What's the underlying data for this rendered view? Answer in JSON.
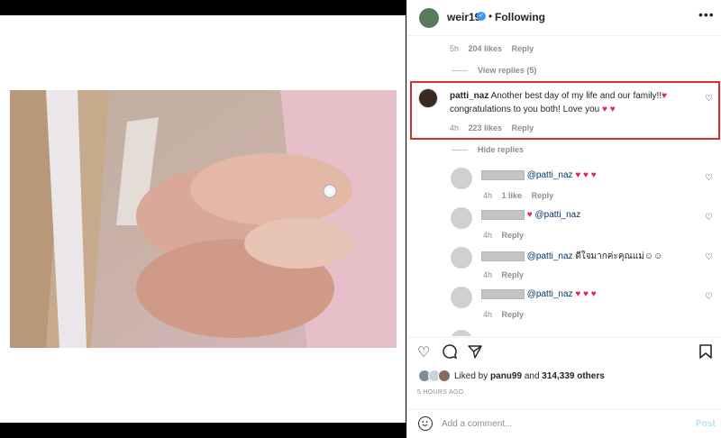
{
  "post": {
    "username": "weir19",
    "verified_mark": "✓",
    "separator": "•",
    "follow_label": "Following",
    "more_label": "•••"
  },
  "prev_comment": {
    "time": "5h",
    "likes": "204 likes",
    "reply_label": "Reply",
    "view_replies": "View replies (5)"
  },
  "highlighted_comment": {
    "username": "patti_naz",
    "text": "Another best day of my life and our family!!",
    "text2": "congratulations to you both! Love you",
    "time": "4h",
    "likes": "223 likes",
    "reply_label": "Reply",
    "hide_replies": "Hide replies",
    "highlight_color": "#d32f2f"
  },
  "replies": [
    {
      "text": "@patti_naz",
      "suffix": "♥ ♥ ♥",
      "time": "4h",
      "likes": "1 like",
      "reply_label": "Reply"
    },
    {
      "prefix": "♥",
      "text": "@patti_naz",
      "time": "4h",
      "reply_label": "Reply"
    },
    {
      "text": "@patti_naz",
      "suffix": "ดีใจมากค่ะคุณแม่☺☺",
      "time": "4h",
      "reply_label": "Reply"
    },
    {
      "text": "@patti_naz",
      "suffix": "♥ ♥ ♥",
      "time": "4h",
      "reply_label": "Reply"
    }
  ],
  "actions": {
    "like_icon": "heart-outline-icon",
    "comment_icon": "comment-icon",
    "share_icon": "paper-plane-icon",
    "save_icon": "bookmark-icon"
  },
  "likes_summary": {
    "prefix": "Liked by",
    "user": "panu99",
    "and": "and",
    "count": "314,339 others"
  },
  "time_ago": "5 HOURS AGO",
  "add_comment": {
    "placeholder": "Add a comment...",
    "post_label": "Post"
  },
  "colors": {
    "accent_red": "#e0245e",
    "link": "#00376b",
    "muted": "#8e8e8e"
  }
}
